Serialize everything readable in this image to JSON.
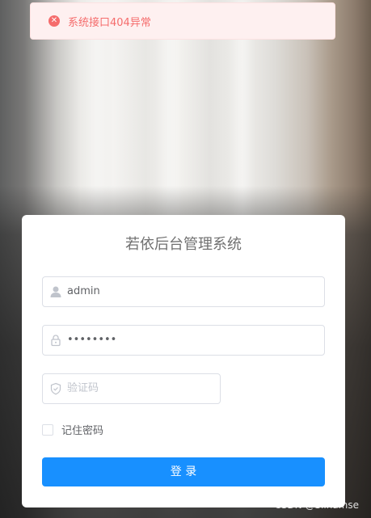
{
  "toast": {
    "message": "系统接口404异常",
    "icon": "error-circle-icon",
    "color": "#f56c6c"
  },
  "login": {
    "title": "若依后台管理系统",
    "username": {
      "value": "admin",
      "icon": "user-icon"
    },
    "password": {
      "value": "••••••••",
      "icon": "lock-icon"
    },
    "captcha": {
      "placeholder": "验证码",
      "icon": "shield-icon"
    },
    "remember_label": "记住密码",
    "remember_checked": false,
    "submit_label": "登 录",
    "accent": "#1890ff"
  },
  "watermark": "CSDN @Slinamse"
}
